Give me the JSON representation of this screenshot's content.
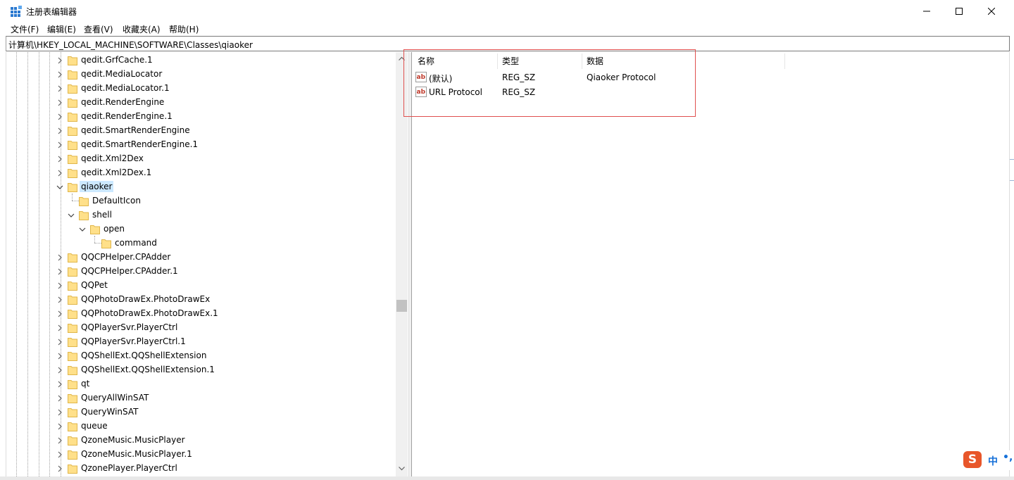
{
  "window": {
    "title": "注册表编辑器",
    "controls": {
      "minimize": "minimize-icon",
      "maximize": "maximize-icon",
      "close": "close-icon"
    }
  },
  "menu": [
    "文件(F)",
    "编辑(E)",
    "查看(V)",
    "收藏夹(A)",
    "帮助(H)"
  ],
  "address": "计算机\\HKEY_LOCAL_MACHINE\\SOFTWARE\\Classes\\qiaoker",
  "tree": [
    {
      "label": "qedit.GrfCache.1",
      "depth": 0,
      "expander": "collapsed"
    },
    {
      "label": "qedit.MediaLocator",
      "depth": 0,
      "expander": "collapsed"
    },
    {
      "label": "qedit.MediaLocator.1",
      "depth": 0,
      "expander": "collapsed"
    },
    {
      "label": "qedit.RenderEngine",
      "depth": 0,
      "expander": "collapsed"
    },
    {
      "label": "qedit.RenderEngine.1",
      "depth": 0,
      "expander": "collapsed"
    },
    {
      "label": "qedit.SmartRenderEngine",
      "depth": 0,
      "expander": "collapsed"
    },
    {
      "label": "qedit.SmartRenderEngine.1",
      "depth": 0,
      "expander": "collapsed"
    },
    {
      "label": "qedit.Xml2Dex",
      "depth": 0,
      "expander": "collapsed"
    },
    {
      "label": "qedit.Xml2Dex.1",
      "depth": 0,
      "expander": "collapsed"
    },
    {
      "label": "qiaoker",
      "depth": 0,
      "expander": "expanded",
      "selected": true
    },
    {
      "label": "DefaultIcon",
      "depth": 1,
      "expander": "none"
    },
    {
      "label": "shell",
      "depth": 1,
      "expander": "expanded"
    },
    {
      "label": "open",
      "depth": 2,
      "expander": "expanded"
    },
    {
      "label": "command",
      "depth": 3,
      "expander": "none"
    },
    {
      "label": "QQCPHelper.CPAdder",
      "depth": 0,
      "expander": "collapsed"
    },
    {
      "label": "QQCPHelper.CPAdder.1",
      "depth": 0,
      "expander": "collapsed"
    },
    {
      "label": "QQPet",
      "depth": 0,
      "expander": "collapsed"
    },
    {
      "label": "QQPhotoDrawEx.PhotoDrawEx",
      "depth": 0,
      "expander": "collapsed"
    },
    {
      "label": "QQPhotoDrawEx.PhotoDrawEx.1",
      "depth": 0,
      "expander": "collapsed"
    },
    {
      "label": "QQPlayerSvr.PlayerCtrl",
      "depth": 0,
      "expander": "collapsed"
    },
    {
      "label": "QQPlayerSvr.PlayerCtrl.1",
      "depth": 0,
      "expander": "collapsed"
    },
    {
      "label": "QQShellExt.QQShellExtension",
      "depth": 0,
      "expander": "collapsed"
    },
    {
      "label": "QQShellExt.QQShellExtension.1",
      "depth": 0,
      "expander": "collapsed"
    },
    {
      "label": "qt",
      "depth": 0,
      "expander": "collapsed"
    },
    {
      "label": "QueryAllWinSAT",
      "depth": 0,
      "expander": "collapsed"
    },
    {
      "label": "QueryWinSAT",
      "depth": 0,
      "expander": "collapsed"
    },
    {
      "label": "queue",
      "depth": 0,
      "expander": "collapsed"
    },
    {
      "label": "QzoneMusic.MusicPlayer",
      "depth": 0,
      "expander": "collapsed"
    },
    {
      "label": "QzoneMusic.MusicPlayer.1",
      "depth": 0,
      "expander": "collapsed"
    },
    {
      "label": "QzonePlayer.PlayerCtrl",
      "depth": 0,
      "expander": "collapsed"
    }
  ],
  "list": {
    "columns": [
      "名称",
      "类型",
      "数据"
    ],
    "rows": [
      {
        "name": "(默认)",
        "type": "REG_SZ",
        "data": "Qiaoker Protocol",
        "icon": "string-value-icon"
      },
      {
        "name": "URL Protocol",
        "type": "REG_SZ",
        "data": "",
        "icon": "string-value-icon"
      }
    ]
  },
  "ime": {
    "logo": "S",
    "lang": "中",
    "punct": "•,"
  },
  "colors": {
    "selection": "#cce8ff",
    "folder": "#ffe08a",
    "folder_edge": "#e0b64a",
    "highlight": "#e0504f",
    "ime_brand": "#e8562a"
  }
}
